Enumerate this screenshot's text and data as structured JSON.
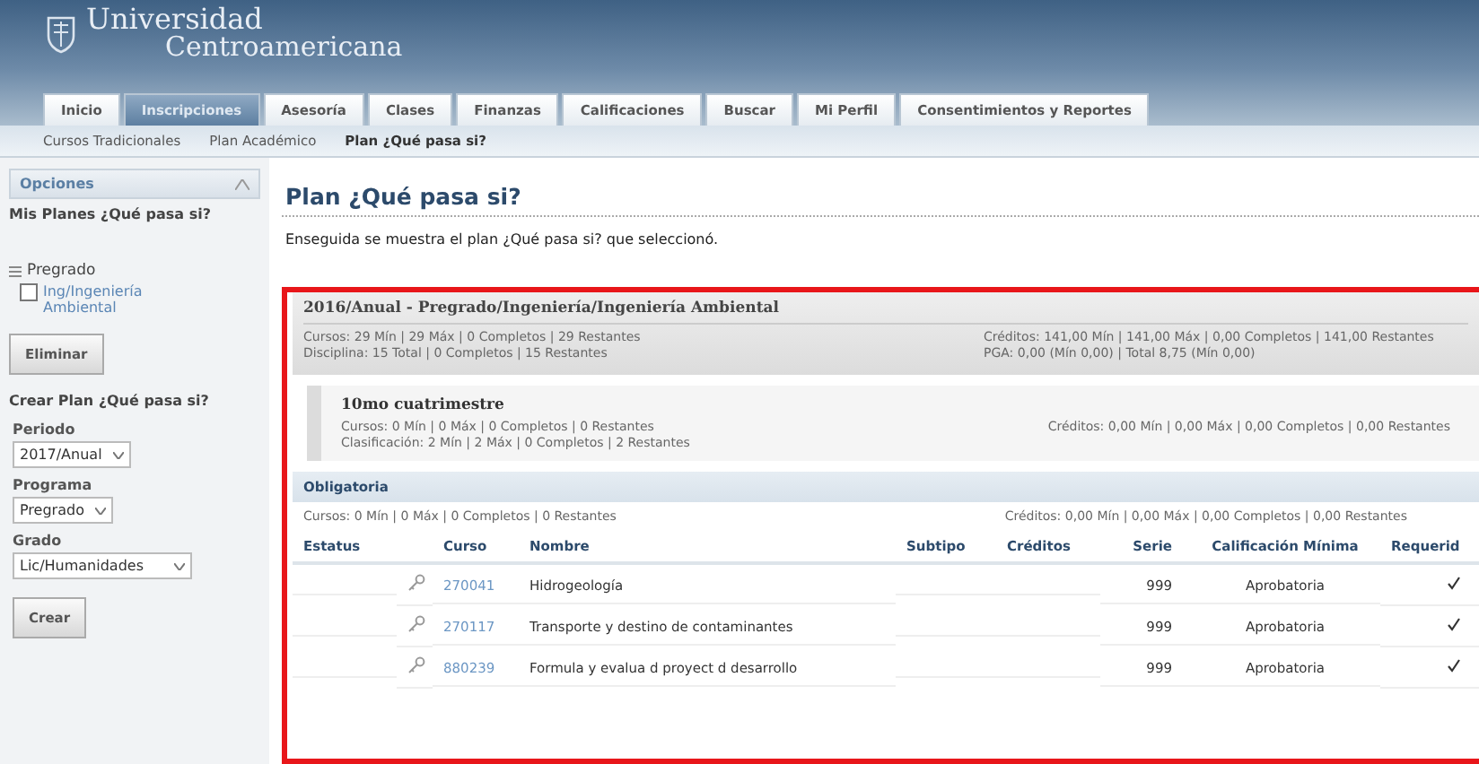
{
  "header": {
    "logo_line1": "Universidad",
    "logo_line2": "Centroamericana"
  },
  "tabs": [
    {
      "label": "Inicio",
      "selected": false
    },
    {
      "label": "Inscripciones",
      "selected": true
    },
    {
      "label": "Asesoría",
      "selected": false
    },
    {
      "label": "Clases",
      "selected": false
    },
    {
      "label": "Finanzas",
      "selected": false
    },
    {
      "label": "Calificaciones",
      "selected": false
    },
    {
      "label": "Buscar",
      "selected": false
    },
    {
      "label": "Mi Perfil",
      "selected": false
    },
    {
      "label": "Consentimientos y Reportes",
      "selected": false
    }
  ],
  "subnav": [
    {
      "label": "Cursos Tradicionales",
      "selected": false
    },
    {
      "label": "Plan Académico",
      "selected": false
    },
    {
      "label": "Plan ¿Qué pasa si?",
      "selected": true
    }
  ],
  "sidebar": {
    "title": "Opciones",
    "my_plans_heading": "Mis Planes ¿Qué pasa si?",
    "tree": [
      {
        "label": "Pregrado",
        "expanded": true,
        "children": [
          {
            "label": "Ing/Ingeniería Ambiental",
            "checked": false
          }
        ]
      }
    ],
    "delete_button": "Eliminar",
    "create_heading": "Crear Plan ¿Qué pasa si?",
    "fields": [
      {
        "label": "Periodo",
        "value": "2017/Anual"
      },
      {
        "label": "Programa",
        "value": "Pregrado"
      },
      {
        "label": "Grado",
        "value": "Lic/Humanidades"
      }
    ],
    "create_button": "Crear"
  },
  "page": {
    "title": "Plan ¿Qué pasa si?",
    "intro": "Enseguida se muestra el plan ¿Qué pasa si? que seleccionó."
  },
  "plan": {
    "title": "2016/Anual - Pregrado/Ingeniería/Ingeniería Ambiental",
    "left": [
      "Cursos: 29 Mín | 29 Máx | 0 Completos | 29 Restantes",
      "Disciplina: 15 Total | 0 Completos | 15 Restantes"
    ],
    "right": [
      "Créditos: 141,00 Mín | 141,00 Máx | 0,00 Completos | 141,00 Restantes",
      "PGA: 0,00 (Mín 0,00) | Total 8,75 (Mín 0,00)"
    ]
  },
  "term": {
    "title": "10mo cuatrimestre",
    "left": [
      "Cursos: 0 Mín | 0 Máx | 0 Completos | 0 Restantes",
      "Clasificación: 2 Mín | 2 Máx | 0 Completos | 2 Restantes"
    ],
    "right": [
      "Créditos: 0,00 Mín | 0,00 Máx | 0,00 Completos | 0,00 Restantes"
    ]
  },
  "group": {
    "title": "Obligatoria",
    "left": "Cursos: 0 Mín | 0 Máx | 0 Completos | 0 Restantes",
    "right": "Créditos: 0,00 Mín | 0,00 Máx | 0,00 Completos | 0,00 Restantes"
  },
  "table": {
    "columns": [
      "Estatus",
      "Curso",
      "Nombre",
      "Subtipo",
      "Créditos",
      "Serie",
      "Calificación Mínima",
      "Requerid"
    ],
    "rows": [
      {
        "course": "270041",
        "name": "Hidrogeología",
        "serie": "999",
        "grade": "Aprobatoria",
        "required": true
      },
      {
        "course": "270117",
        "name": "Transporte y destino de contaminantes",
        "serie": "999",
        "grade": "Aprobatoria",
        "required": true
      },
      {
        "course": "880239",
        "name": "Formula y evalua d proyect d desarrollo",
        "serie": "999",
        "grade": "Aprobatoria",
        "required": true
      }
    ]
  }
}
